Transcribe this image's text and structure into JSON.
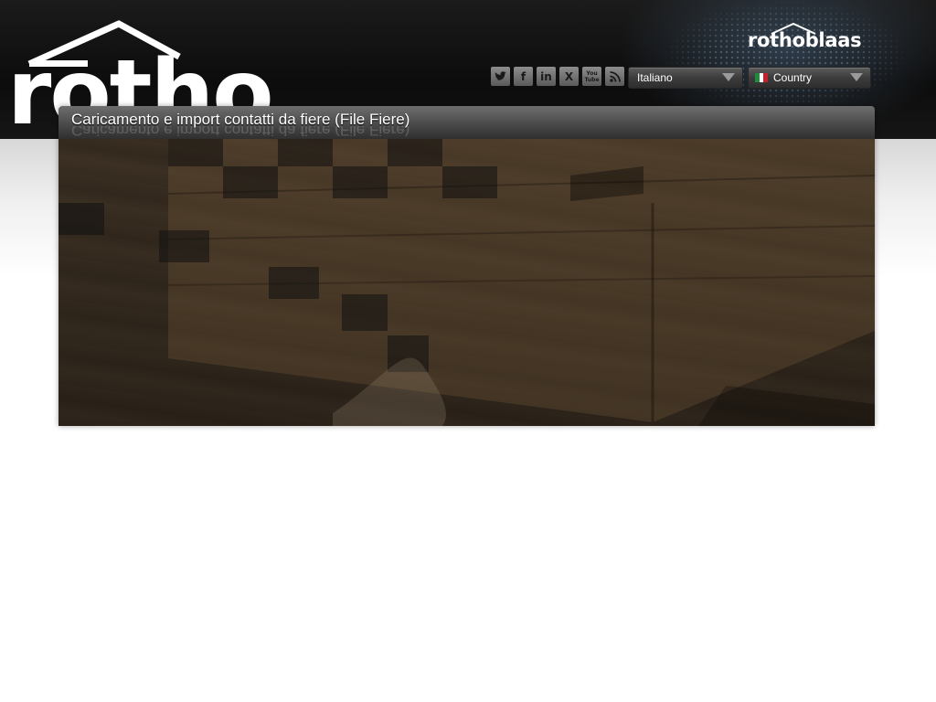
{
  "header": {
    "site_logo_text": "rotho",
    "brand_name": "rothoblaas"
  },
  "social_icons": [
    {
      "icon": "twitter-icon",
      "glyph": "t"
    },
    {
      "icon": "facebook-icon",
      "glyph": "f"
    },
    {
      "icon": "linkedin-icon",
      "glyph": "in"
    },
    {
      "icon": "xing-icon",
      "glyph": "X"
    },
    {
      "icon": "youtube-icon",
      "glyph": "You Tube"
    },
    {
      "icon": "rss-icon",
      "glyph": ""
    }
  ],
  "language_select": {
    "selected": "Italiano"
  },
  "country_select": {
    "selected": "Country",
    "flag": [
      "#1f8a3b",
      "#ffffff",
      "#c8202a"
    ]
  },
  "main": {
    "title": "Caricamento e import contatti da fiere (File Fiere)"
  },
  "colors": {
    "header_bg": "#111111",
    "panel_title_bg": "#4a4a4a"
  }
}
